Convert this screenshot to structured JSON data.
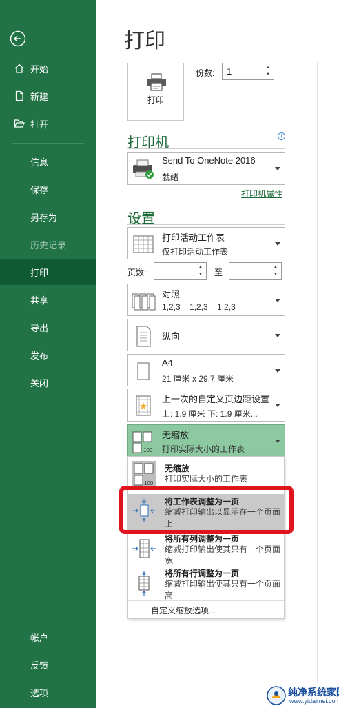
{
  "sidebar": {
    "top_items": [
      {
        "label": "开始",
        "icon": "home-icon"
      },
      {
        "label": "新建",
        "icon": "new-document-icon"
      },
      {
        "label": "打开",
        "icon": "open-folder-icon"
      }
    ],
    "items": [
      {
        "label": "信息"
      },
      {
        "label": "保存"
      },
      {
        "label": "另存为"
      },
      {
        "label": "历史记录"
      },
      {
        "label": "打印"
      },
      {
        "label": "共享"
      },
      {
        "label": "导出"
      },
      {
        "label": "发布"
      },
      {
        "label": "关闭"
      }
    ],
    "bottom_items": [
      {
        "label": "帐户"
      },
      {
        "label": "反馈"
      },
      {
        "label": "选项"
      }
    ],
    "active": "打印"
  },
  "main": {
    "title": "打印",
    "print_button_label": "打印",
    "copies_label": "份数:",
    "copies_value": "1",
    "printer_section_title": "打印机",
    "printer": {
      "name": "Send To OneNote 2016",
      "status": "就绪"
    },
    "printer_properties_link": "打印机属性",
    "settings_section_title": "设置",
    "what_to_print": {
      "title": "打印活动工作表",
      "subtitle": "仅打印活动工作表"
    },
    "pages_label": "页数:",
    "pages_to_label": "至",
    "collation": {
      "title": "对照",
      "subtitle": "1,2,3    1,2,3    1,2,3"
    },
    "orientation": {
      "title": "纵向"
    },
    "paper": {
      "title": "A4",
      "subtitle": "21 厘米 x 29.7 厘米"
    },
    "margins": {
      "title": "上一次的自定义页边距设置",
      "subtitle": "上: 1.9 厘米 下: 1.9 厘米..."
    },
    "scaling": {
      "title": "无缩放",
      "subtitle": "打印实际大小的工作表"
    }
  },
  "scaling_menu": {
    "options": [
      {
        "title": "无缩放",
        "desc": "打印实际大小的工作表"
      },
      {
        "title": "将工作表调整为一页",
        "desc": "缩减打印输出以显示在一个页面上"
      },
      {
        "title": "将所有列调整为一页",
        "desc": "缩减打印输出使其只有一个页面宽"
      },
      {
        "title": "将所有行调整为一页",
        "desc": "缩减打印输出使其只有一个页面高"
      }
    ],
    "custom_link": "自定义缩放选项..."
  },
  "watermark": {
    "text": "纯净系统家园",
    "url": "www.yidaimei.com"
  },
  "colors": {
    "sidebar": "#217346",
    "active": "#0f5a30",
    "selected": "#8cc9a0",
    "highlight": "#e0141f"
  }
}
